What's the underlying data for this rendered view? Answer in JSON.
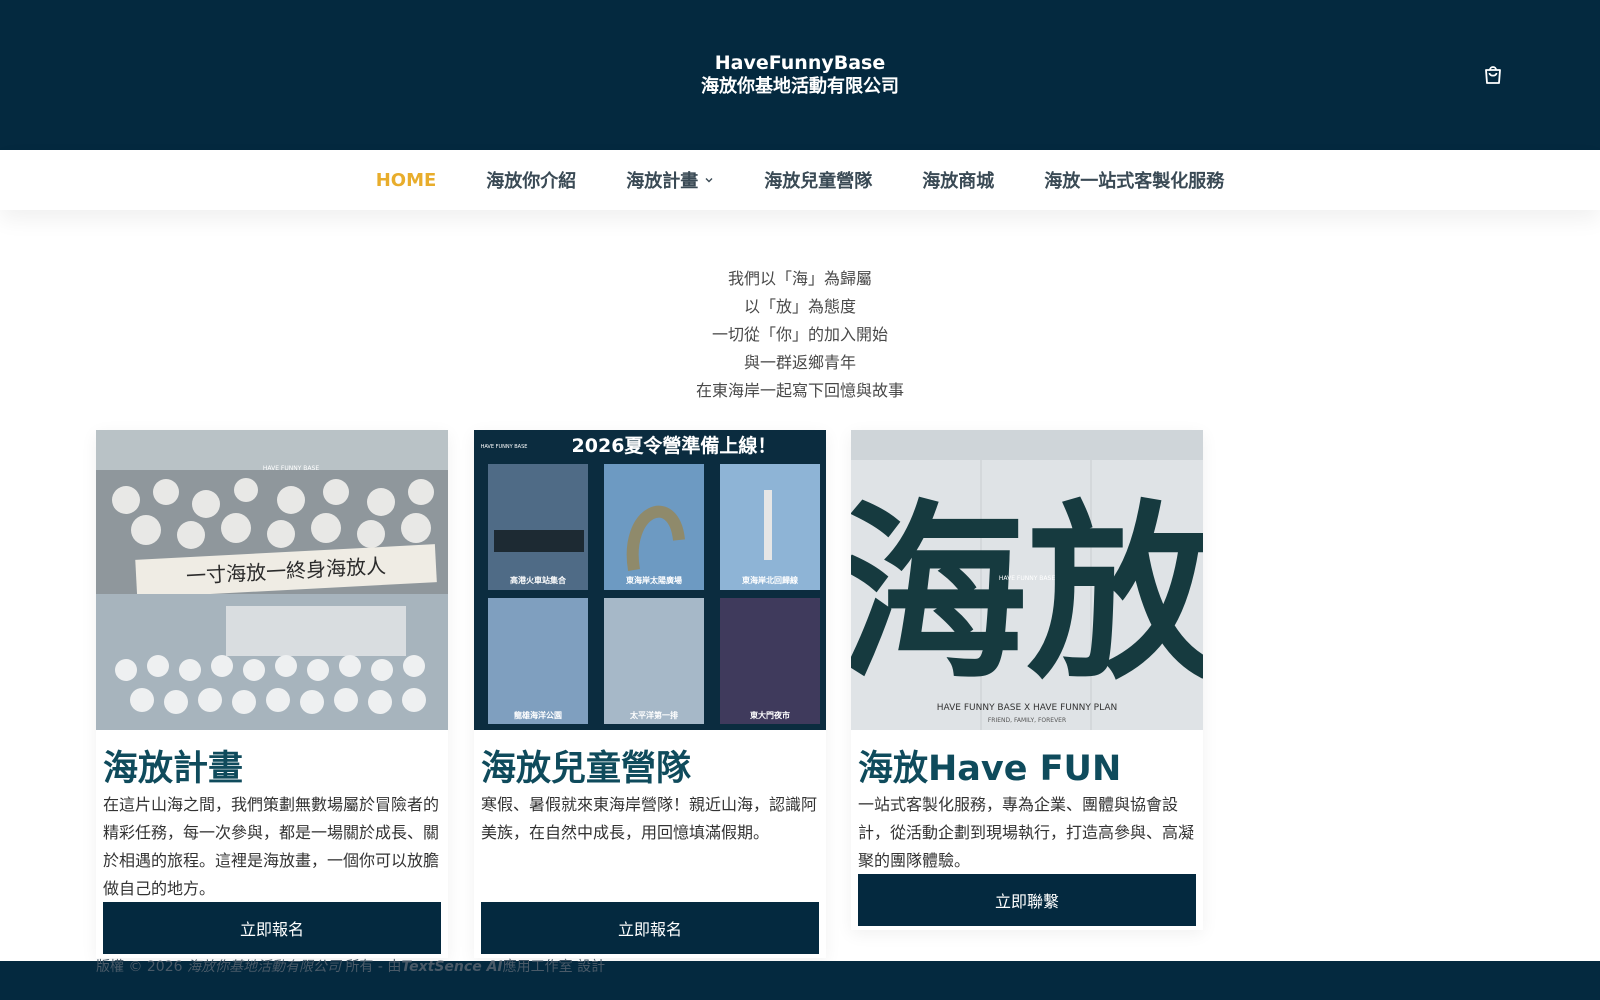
{
  "header": {
    "brand_line1": "HaveFunnyBase",
    "brand_line2": "海放你基地活動有限公司",
    "cart_icon": "shopping-bag-icon"
  },
  "nav": {
    "items": [
      {
        "label": "HOME",
        "active": true
      },
      {
        "label": "海放你介紹"
      },
      {
        "label": "海放計畫",
        "has_dropdown": true
      },
      {
        "label": "海放兒童營隊"
      },
      {
        "label": "海放商城"
      },
      {
        "label": "海放一站式客製化服務"
      }
    ]
  },
  "intro": {
    "lines": [
      "我們以「海」為歸屬",
      "以「放」為態度",
      "一切從「你」的加入開始",
      "與一群返鄉青年",
      "在東海岸一起寫下回憶與故事"
    ]
  },
  "cards": [
    {
      "title": "海放計畫",
      "text": "在這片山海之間，我們策劃無數場屬於冒險者的精彩任務，每一次參與，都是一場關於成長、關於相遇的旅程。這裡是海放畫，一個你可以放膽做自己的地方。",
      "button": "立即報名",
      "image": {
        "banner_text": "一寸海放一終身海放人",
        "logo_text": "HAVE FUNNY BASE"
      }
    },
    {
      "title": "海放兒童營隊",
      "text": "寒假、暑假就來東海岸營隊！親近山海，認識阿美族，在自然中成長，用回憶填滿假期。",
      "button": "立即報名",
      "image": {
        "headline": "2026夏令營準備上線！",
        "logo_text": "HAVE FUNNY BASE",
        "captions": [
          "高港火車站集合",
          "東海岸太陽廣場",
          "東海岸北回歸線",
          "龍雄海洋公園",
          "太平洋第一排",
          "東大門夜市"
        ]
      }
    },
    {
      "title": "海放Have FUN",
      "text": "一站式客製化服務，專為企業、團體與協會設計，從活動企劃到現場執行，打造高參與、高凝聚的團隊體驗。",
      "button": "立即聯繫",
      "image": {
        "calligraphy": "海放",
        "logo_text": "HAVE FUNNY BASE",
        "plan_text": "HAVE FUNNY BASE X HAVE FUNNY PLAN",
        "slogan": "FRIEND, FAMILY, FOREVER"
      }
    }
  ],
  "footer": {
    "prefix": "版權 © 2026 ",
    "company": "海放你基地活動有限公司",
    "middle": " 所有 - 由",
    "studio": "TextSence AI",
    "suffix": "應用工作室 設計"
  },
  "colors": {
    "primary": "#04293f",
    "accent": "#e8ad2c",
    "title": "#0f4b5c"
  }
}
